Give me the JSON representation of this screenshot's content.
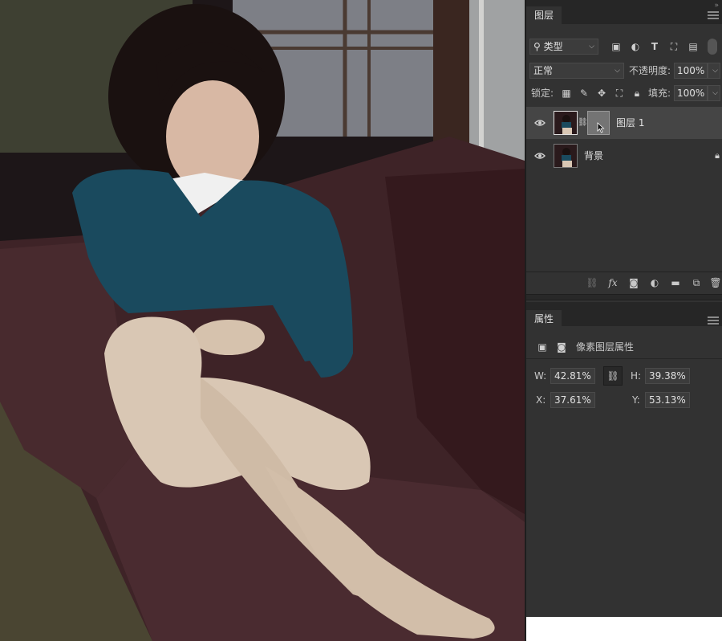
{
  "layers_panel": {
    "tab_label": "图层",
    "filter_kind": "类型",
    "blend_mode": "正常",
    "opacity_label": "不透明度:",
    "opacity_value": "100%",
    "lock_label": "锁定:",
    "fill_label": "填充:",
    "fill_value": "100%",
    "layers": [
      {
        "name": "图层 1",
        "selected": true,
        "has_mask": true
      },
      {
        "name": "背景",
        "selected": false,
        "locked": true
      }
    ],
    "bottom_tools": [
      "link-icon",
      "fx-icon",
      "mask-icon",
      "adjustment-icon",
      "folder-icon",
      "new-layer-icon",
      "trash-icon"
    ]
  },
  "properties_panel": {
    "tab_label": "属性",
    "heading": "像素图层属性",
    "w_label": "W:",
    "w_value": "42.81%",
    "h_label": "H:",
    "h_value": "39.38%",
    "x_label": "X:",
    "x_value": "37.61%",
    "y_label": "Y:",
    "y_value": "53.13%"
  },
  "colors": {
    "panel_bg": "#323232",
    "tabbar_bg": "#262626",
    "selected_row": "#454545",
    "sofa": "#3e2327",
    "sweater": "#1a4a5e",
    "skin": "#d9c7b4"
  }
}
